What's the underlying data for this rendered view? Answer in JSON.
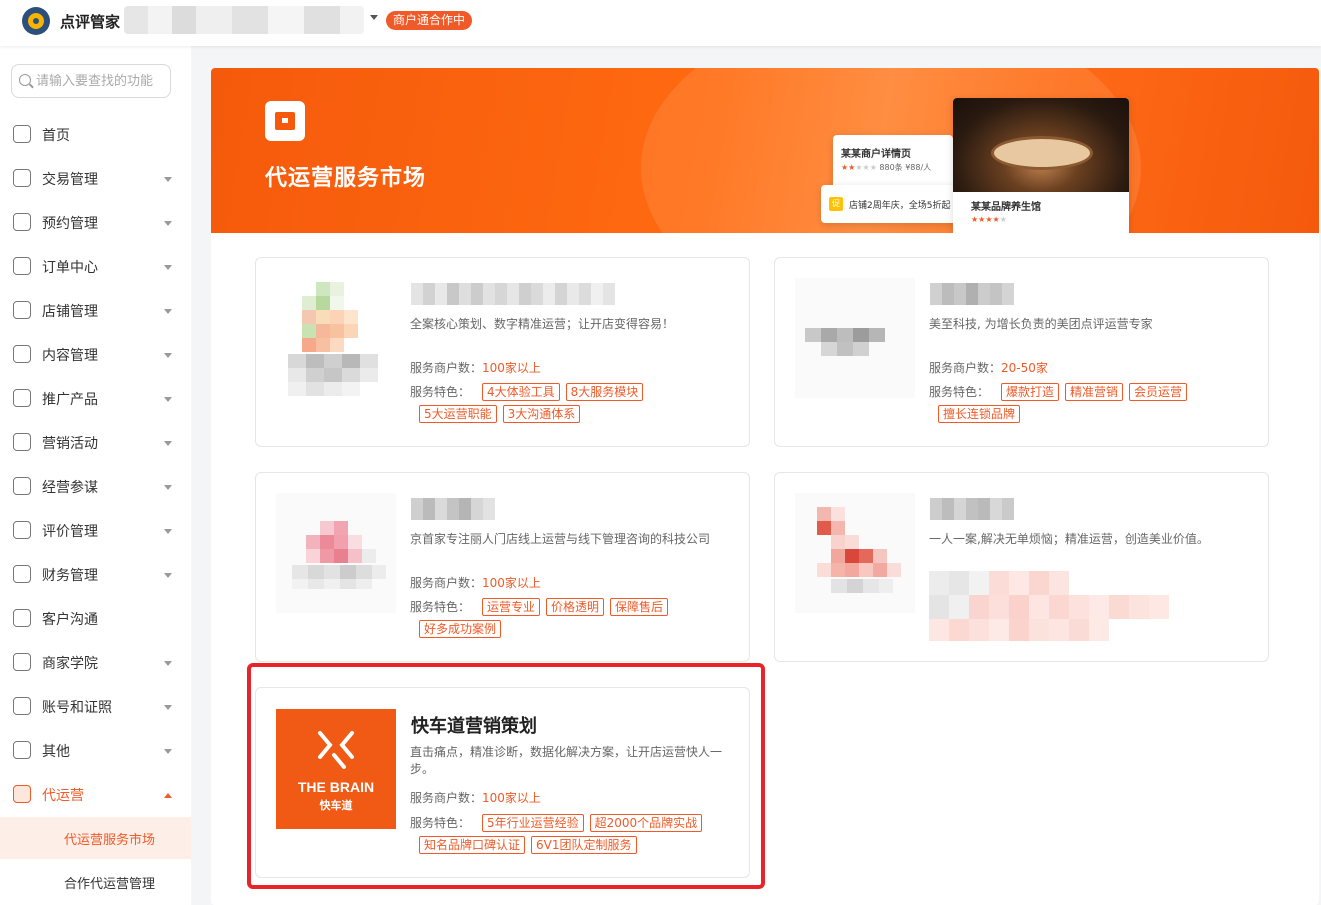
{
  "topbar": {
    "app_name": "点评管家",
    "badge": "商户通合作中"
  },
  "sidebar": {
    "search_placeholder": "请输入要查找的功能",
    "items": [
      {
        "label": "首页",
        "icon": "monitor-icon",
        "caret": false
      },
      {
        "label": "交易管理",
        "icon": "transaction-icon",
        "caret": true
      },
      {
        "label": "预约管理",
        "icon": "calendar-check-icon",
        "caret": true
      },
      {
        "label": "订单中心",
        "icon": "clipboard-icon",
        "caret": true
      },
      {
        "label": "店铺管理",
        "icon": "store-icon",
        "caret": true
      },
      {
        "label": "内容管理",
        "icon": "content-icon",
        "caret": true
      },
      {
        "label": "推广产品",
        "icon": "megaphone-icon",
        "caret": true
      },
      {
        "label": "营销活动",
        "icon": "users-icon",
        "caret": true
      },
      {
        "label": "经营参谋",
        "icon": "gauge-icon",
        "caret": true
      },
      {
        "label": "评价管理",
        "icon": "thumbs-up-icon",
        "caret": true
      },
      {
        "label": "财务管理",
        "icon": "yen-icon",
        "caret": true
      },
      {
        "label": "客户沟通",
        "icon": "chat-icon",
        "caret": false
      },
      {
        "label": "商家学院",
        "icon": "graduation-icon",
        "caret": true
      },
      {
        "label": "账号和证照",
        "icon": "account-icon",
        "caret": true
      },
      {
        "label": "其他",
        "icon": "grid-icon",
        "caret": true
      },
      {
        "label": "代运营",
        "icon": "chart-icon",
        "caret": true,
        "active": true
      }
    ],
    "sub_items": [
      {
        "label": "代运营服务市场",
        "active": true
      },
      {
        "label": "合作代运营管理",
        "active": false
      }
    ]
  },
  "banner": {
    "title": "代运营服务市场",
    "mock_detail_title": "某某商户详情页",
    "mock_detail_sub": "880条 ¥88/人",
    "mock_promo_badge": "促",
    "mock_promo": "店铺2周年庆，全场5折起",
    "mock_shop_name": "某某品牌养生馆"
  },
  "labels": {
    "count": "服务商户数：",
    "features": "服务特色："
  },
  "cards": [
    {
      "desc": "全案核心策划、数字精准运营；让开店变得容易！",
      "count": "100家以上",
      "tags": [
        "4大体验工具",
        "8大服务模块",
        "5大运营职能",
        "3大沟通体系"
      ]
    },
    {
      "desc": "美至科技, 为增长负责的美团点评运营专家",
      "count": "20-50家",
      "tags": [
        "爆款打造",
        "精准营销",
        "会员运营",
        "擅长连锁品牌"
      ]
    },
    {
      "desc": "京首家专注丽人门店线上运营与线下管理咨询的科技公司",
      "count": "100家以上",
      "tags": [
        "运营专业",
        "价格透明",
        "保障售后",
        "好多成功案例"
      ]
    },
    {
      "desc": "一人一案,解决无单烦恼；精准运营，创造美业价值。"
    },
    {
      "name": "快车道营销策划",
      "logo_text": "THE BRAIN",
      "logo_sub": "快车道",
      "desc": "直击痛点，精准诊断，数据化解决方案，让开店运营快人一步。",
      "count": "100家以上",
      "tags": [
        "5年行业运营经验",
        "超2000个品牌实战",
        "知名品牌口碑认证",
        "6V1团队定制服务"
      ]
    }
  ],
  "colors": {
    "accent": "#f05a28",
    "highlight": "#e8242a",
    "banner": "#f55a0c"
  }
}
